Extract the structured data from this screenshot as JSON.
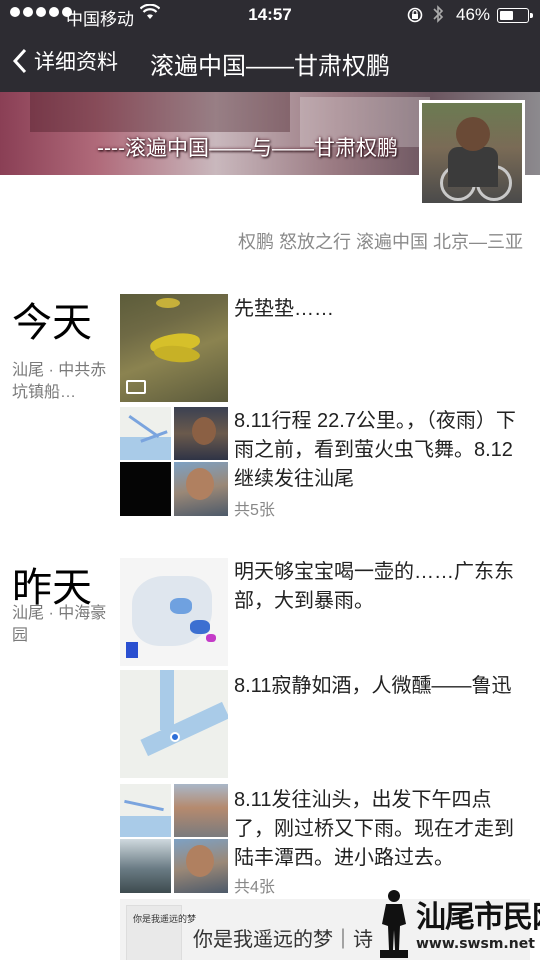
{
  "status_bar": {
    "carrier": "中国移动",
    "time": "14:57",
    "battery_percent": "46%",
    "battery_level": 0.46
  },
  "nav": {
    "back_label": "详细资料",
    "title": "滚遍中国——甘肃权鹏"
  },
  "profile": {
    "cover_text": "----滚遍中国——与——甘肃权鹏",
    "signature": "权鹏 怒放之行 滚遍中国 北京—三亚"
  },
  "timeline": {
    "today": {
      "label": "今天",
      "location": "汕尾 · 中共赤坑镇船…",
      "posts": [
        {
          "text": "先垫垫……"
        },
        {
          "text": "8.11行程 22.7公里。，（夜雨）下雨之前，看到萤火虫飞舞。8.12继续发往汕尾",
          "count": "共5张"
        }
      ]
    },
    "yesterday": {
      "label": "昨天",
      "location": "汕尾 · 中海豪园",
      "posts": [
        {
          "text": "明天够宝宝喝一壶的……广东东部，大到暴雨。"
        },
        {
          "text": "8.11寂静如酒，人微醺——鲁迅"
        },
        {
          "text": "8.11发往汕头，出发下午四点了，刚过桥又下雨。现在才走到陆丰潭西。进小路过去。",
          "count": "共4张"
        }
      ]
    },
    "music": {
      "cover_text": "你是我遥远的梦",
      "title": "你是我遥远的梦｜诗"
    }
  },
  "watermark": {
    "title": "汕尾市民网",
    "url": "www.swsm.net"
  },
  "colors": {
    "navbar": "#2d2c32",
    "music_bg": "#f2f2f2",
    "meta_text": "#8a8a8a"
  }
}
